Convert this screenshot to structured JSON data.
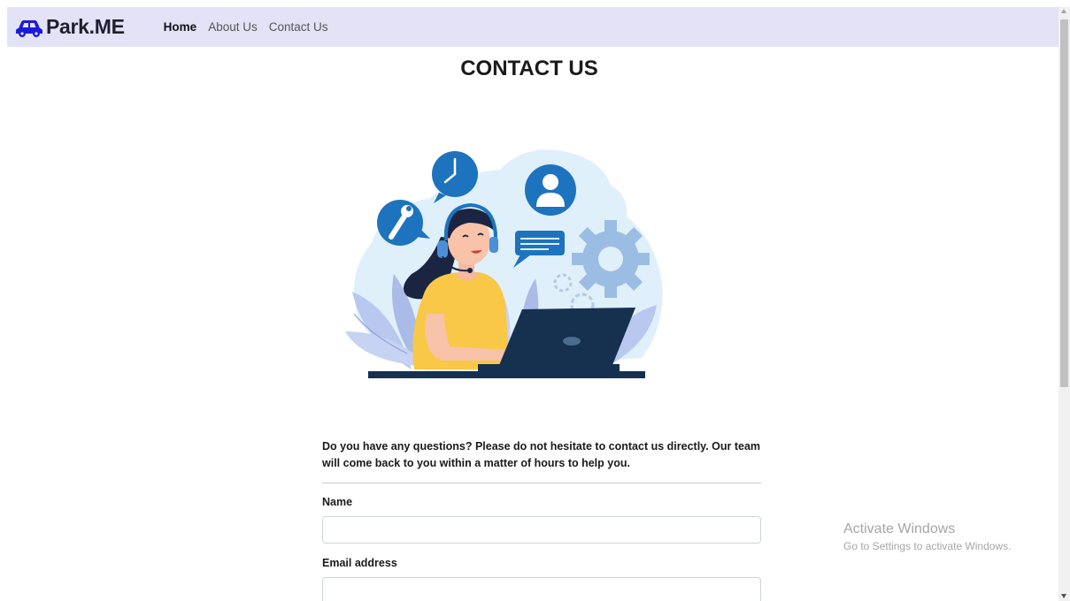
{
  "brand": {
    "name": "Park.ME",
    "icon": "car-icon",
    "icon_color": "#1a1adb"
  },
  "nav": {
    "items": [
      {
        "label": "Home",
        "active": true
      },
      {
        "label": "About Us",
        "active": false
      },
      {
        "label": "Contact Us",
        "active": false
      }
    ]
  },
  "page": {
    "title": "CONTACT US"
  },
  "hero": {
    "icon": "customer-support-illustration"
  },
  "intro": {
    "text": "Do you have any questions? Please do not hesitate to contact us directly. Our team will come back to you within a matter of hours to help you."
  },
  "form": {
    "name_label": "Name",
    "name_value": "",
    "email_label": "Email address",
    "email_value": ""
  },
  "watermark": {
    "title": "Activate Windows",
    "subtitle": "Go to Settings to activate Windows."
  },
  "colors": {
    "navbar_bg": "#e3e2f7",
    "illustration_blue": "#1e73be",
    "illustration_yellow": "#f9c846",
    "laptop_navy": "#16304f"
  }
}
